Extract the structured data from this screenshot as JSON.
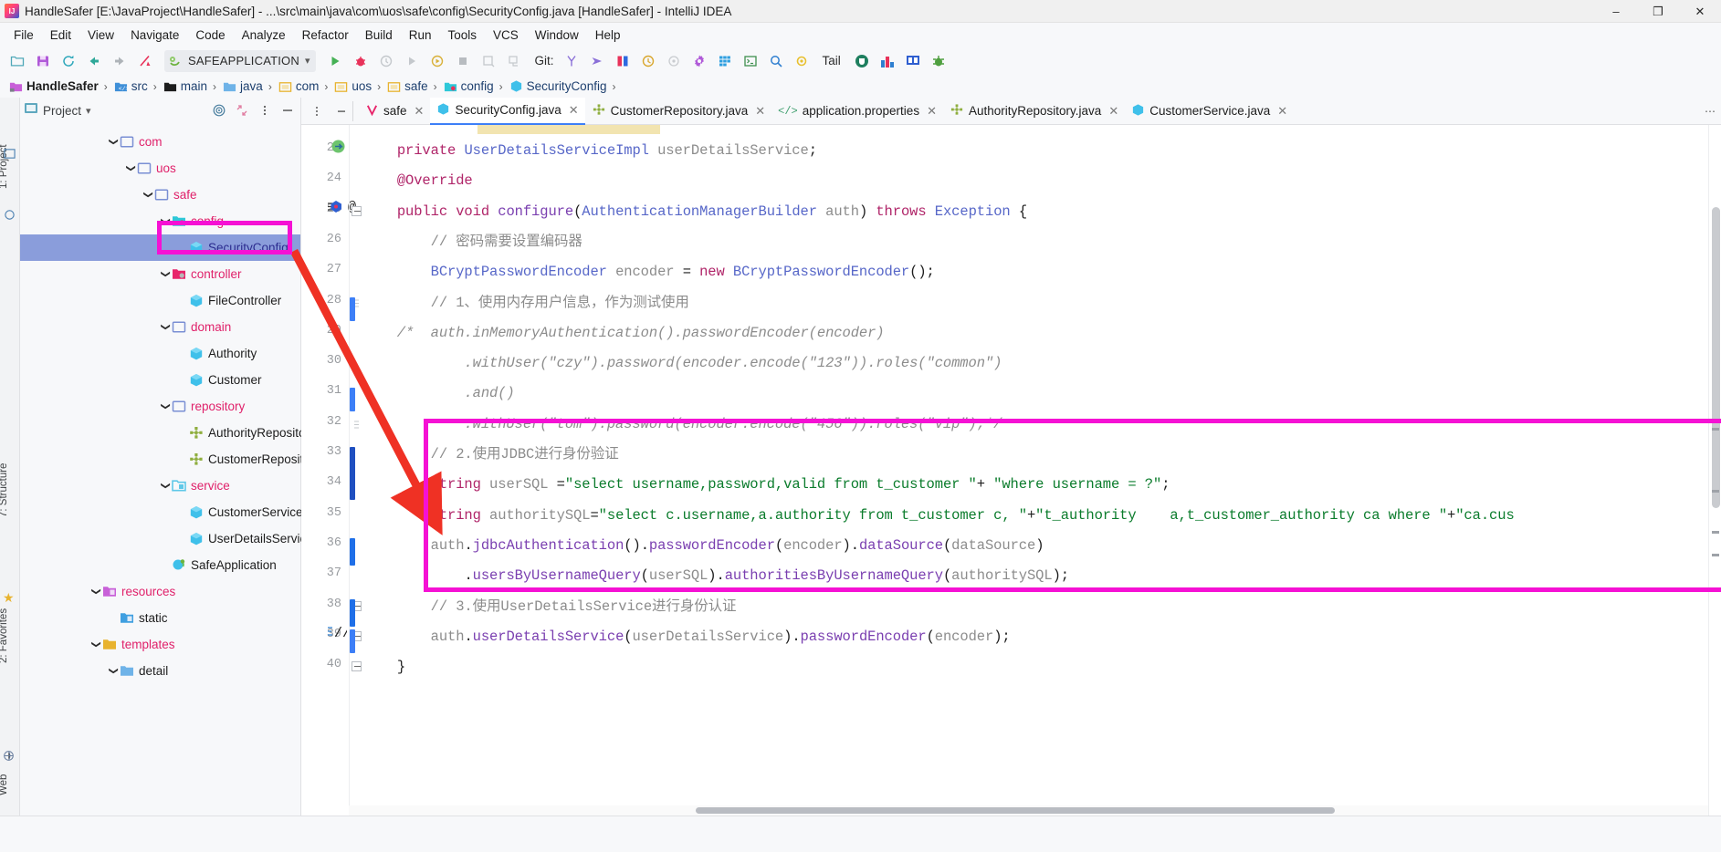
{
  "window": {
    "title": "HandleSafer [E:\\JavaProject\\HandleSafer] - ...\\src\\main\\java\\com\\uos\\safe\\config\\SecurityConfig.java [HandleSafer] - IntelliJ IDEA",
    "app_icon": "intellij-idea-icon",
    "minimize": "–",
    "maximize": "❐",
    "close": "✕"
  },
  "menubar": {
    "items": [
      {
        "label": "File"
      },
      {
        "label": "Edit"
      },
      {
        "label": "View"
      },
      {
        "label": "Navigate"
      },
      {
        "label": "Code"
      },
      {
        "label": "Analyze"
      },
      {
        "label": "Refactor"
      },
      {
        "label": "Build"
      },
      {
        "label": "Run"
      },
      {
        "label": "Tools"
      },
      {
        "label": "VCS"
      },
      {
        "label": "Window"
      },
      {
        "label": "Help"
      }
    ]
  },
  "toolbar": {
    "run_config": "SAFEAPPLICATION",
    "run_config_icon": "spring-boot-icon",
    "dropdown_icon": "chevron-down-icon",
    "git_label": "Git:",
    "tail_label": "Tail",
    "icons": [
      "open-folder-icon",
      "save-all-icon",
      "sync-icon",
      "back-icon",
      "forward-icon",
      "build-icon",
      "run-icon",
      "debug-icon",
      "coverage-icon",
      "profile-icon",
      "attach-debugger-icon",
      "stop-icon",
      "step-icon",
      "stack-icon",
      "git-branch-icon",
      "git-push-icon",
      "git-diff-icon",
      "git-history-icon",
      "git-revert-icon",
      "settings-gear-icon",
      "structure-grid-icon",
      "terminal-icon",
      "search-icon",
      "bug-yellow-icon",
      "coffee-icon",
      "database-icon",
      "monitor-icon",
      "bug-green-icon"
    ]
  },
  "breadcrumb": {
    "items": [
      {
        "label": "HandleSafer",
        "icon": "project-folder-icon"
      },
      {
        "label": "src",
        "icon": "source-folder-icon"
      },
      {
        "label": "main",
        "icon": "folder-dark-icon"
      },
      {
        "label": "java",
        "icon": "folder-blue-icon"
      },
      {
        "label": "com",
        "icon": "package-icon"
      },
      {
        "label": "uos",
        "icon": "package-icon"
      },
      {
        "label": "safe",
        "icon": "package-icon"
      },
      {
        "label": "config",
        "icon": "package-config-icon"
      },
      {
        "label": "SecurityConfig",
        "icon": "java-class-icon"
      }
    ],
    "separator": "›"
  },
  "left_strips": {
    "project_label": "1: Project",
    "structure_label": "7: Structure",
    "favorites_label": "2: Favorites",
    "web_label": "Web"
  },
  "project_panel": {
    "title": "Project",
    "title_dropdown_icon": "chevron-down-icon",
    "target_icon": "locate-target-icon",
    "collapse_icon": "collapse-all-icon",
    "more_icon": "more-options-icon",
    "hide_icon": "hide-panel-icon",
    "tree": [
      {
        "label": "com",
        "indent": 5,
        "chevron": "⌄",
        "icon": "package-icon",
        "kind": "folder",
        "selected": false
      },
      {
        "label": "uos",
        "indent": 6,
        "chevron": "⌄",
        "icon": "package-icon",
        "kind": "folder",
        "selected": false
      },
      {
        "label": "safe",
        "indent": 7,
        "chevron": "⌄",
        "icon": "package-icon",
        "kind": "folder",
        "selected": false
      },
      {
        "label": "config",
        "indent": 8,
        "chevron": "⌄",
        "icon": "package-config-icon",
        "kind": "folder-cyan",
        "selected": false
      },
      {
        "label": "SecurityConfig",
        "indent": 9,
        "chevron": "",
        "icon": "java-class-icon",
        "kind": "class-sel",
        "selected": true
      },
      {
        "label": "controller",
        "indent": 8,
        "chevron": "⌄",
        "icon": "package-pink-icon",
        "kind": "folder-pink",
        "selected": false
      },
      {
        "label": "FileController",
        "indent": 9,
        "chevron": "",
        "icon": "java-class-icon",
        "kind": "class",
        "selected": false
      },
      {
        "label": "domain",
        "indent": 8,
        "chevron": "⌄",
        "icon": "package-icon",
        "kind": "folder",
        "selected": false
      },
      {
        "label": "Authority",
        "indent": 9,
        "chevron": "",
        "icon": "java-class-icon",
        "kind": "class",
        "selected": false
      },
      {
        "label": "Customer",
        "indent": 9,
        "chevron": "",
        "icon": "java-class-icon",
        "kind": "class",
        "selected": false
      },
      {
        "label": "repository",
        "indent": 8,
        "chevron": "⌄",
        "icon": "package-icon",
        "kind": "folder",
        "selected": false
      },
      {
        "label": "AuthorityRepository",
        "indent": 9,
        "chevron": "",
        "icon": "spring-bean-icon",
        "kind": "class",
        "selected": false
      },
      {
        "label": "CustomerRepository",
        "indent": 9,
        "chevron": "",
        "icon": "spring-bean-icon",
        "kind": "class",
        "selected": false
      },
      {
        "label": "service",
        "indent": 8,
        "chevron": "⌄",
        "icon": "package-cyan-icon",
        "kind": "folder",
        "selected": false
      },
      {
        "label": "CustomerService",
        "indent": 9,
        "chevron": "",
        "icon": "java-class-icon",
        "kind": "class",
        "selected": false
      },
      {
        "label": "UserDetailsServiceIm",
        "indent": 9,
        "chevron": "",
        "icon": "java-class-icon",
        "kind": "class",
        "selected": false
      },
      {
        "label": "SafeApplication",
        "indent": 8,
        "chevron": "",
        "icon": "spring-app-icon",
        "kind": "class",
        "selected": false
      },
      {
        "label": "resources",
        "indent": 4,
        "chevron": "⌄",
        "icon": "resources-folder-icon",
        "kind": "folder",
        "selected": false
      },
      {
        "label": "static",
        "indent": 5,
        "chevron": "",
        "icon": "static-folder-icon",
        "kind": "class",
        "selected": false
      },
      {
        "label": "templates",
        "indent": 4,
        "chevron": "⌄",
        "icon": "templates-folder-icon",
        "kind": "folder",
        "selected": false
      },
      {
        "label": "detail",
        "indent": 5,
        "chevron": "⌄",
        "icon": "folder-blue-icon",
        "kind": "class",
        "selected": false
      }
    ]
  },
  "editor": {
    "tabs": [
      {
        "label": "safe",
        "icon": "vcs-branch-icon",
        "active": false,
        "close": "✕"
      },
      {
        "label": "SecurityConfig.java",
        "icon": "java-class-icon",
        "active": true,
        "close": "✕"
      },
      {
        "label": "CustomerRepository.java",
        "icon": "spring-bean-icon",
        "active": false,
        "close": "✕"
      },
      {
        "label": "application.properties",
        "icon": "properties-icon",
        "active": false,
        "close": "✕"
      },
      {
        "label": "AuthorityRepository.java",
        "icon": "spring-bean-icon",
        "active": false,
        "close": "✕"
      },
      {
        "label": "CustomerService.java",
        "icon": "java-class-icon",
        "active": false,
        "close": "✕"
      }
    ],
    "tab_overflow_icon": "more-tabs-icon",
    "gutter_left_icons": [
      "more-options-icon",
      "hide-panel-icon"
    ],
    "line_numbers": [
      23,
      24,
      25,
      26,
      27,
      28,
      29,
      30,
      31,
      32,
      33,
      34,
      35,
      36,
      37,
      38,
      39,
      40
    ],
    "code_lines": [
      {
        "n": 23,
        "text": "    private UserDetailsServiceImpl userDetailsService;"
      },
      {
        "n": 24,
        "text": "    @Override"
      },
      {
        "n": 25,
        "text": "    public void configure(AuthenticationManagerBuilder auth) throws Exception {"
      },
      {
        "n": 26,
        "text": "        // 密码需要设置编码器"
      },
      {
        "n": 27,
        "text": "        BCryptPasswordEncoder encoder = new BCryptPasswordEncoder();"
      },
      {
        "n": 28,
        "text": "        // 1、使用内存用户信息，作为测试使用"
      },
      {
        "n": 29,
        "text": "    /*  auth.inMemoryAuthentication().passwordEncoder(encoder)"
      },
      {
        "n": 30,
        "text": "            .withUser(\"czy\").password(encoder.encode(\"123\")).roles(\"common\")"
      },
      {
        "n": 31,
        "text": "            .and()"
      },
      {
        "n": 32,
        "text": "            .withUser(\"tom\").password(encoder.encode(\"456\")).roles(\"vip\");*/"
      },
      {
        "n": 33,
        "text": "        // 2.使用JDBC进行身份验证"
      },
      {
        "n": 34,
        "text": "        String userSQL =\"select username,password,valid from t_customer \"+ \"where username = ?\";"
      },
      {
        "n": 35,
        "text": "        String authoritySQL=\"select c.username,a.authority from t_customer c, \"+\"t_authority    a,t_customer_authority ca where \"+\"ca.cus"
      },
      {
        "n": 36,
        "text": "        auth.jdbcAuthentication().passwordEncoder(encoder).dataSource(dataSource)"
      },
      {
        "n": 37,
        "text": "            .usersByUsernameQuery(userSQL).authoritiesByUsernameQuery(authoritySQL);"
      },
      {
        "n": 38,
        "text": "        // 3.使用UserDetailsService进行身份认证"
      },
      {
        "n": 39,
        "text": "        auth.userDetailsService(userDetailsService).passwordEncoder(encoder);"
      },
      {
        "n": 40,
        "text": "    }"
      }
    ],
    "gutter_markers": [
      {
        "line": 23,
        "icon": "override-method-icon"
      },
      {
        "line": 25,
        "icon": "spring-bean-gutter-icon"
      },
      {
        "line": 25,
        "icon": "annotation-at-icon"
      },
      {
        "line": 39,
        "icon": "comment-slashes-icon"
      }
    ]
  },
  "annotations": {
    "highlight_color": "#f511d4",
    "arrow_color": "#ef3124",
    "box_sidebar_name": "securityconfig-tree-highlight",
    "box_code_name": "jdbc-auth-code-highlight",
    "arrow_name": "pointer-arrow"
  },
  "statusbar": {
    "text": ""
  }
}
